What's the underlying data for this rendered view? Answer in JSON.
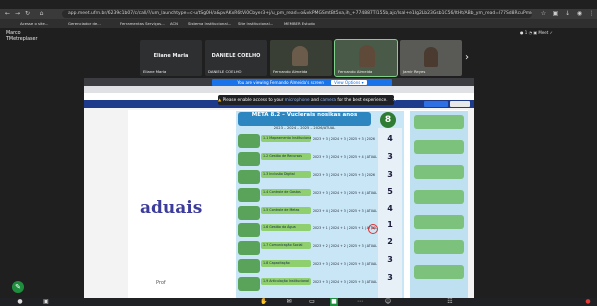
{
  "browser": {
    "url": "app.meet.ufrn.br/6239c1b07/c/call/?/um_launchtype=c-u/tSg0H/a&pvAKxR6tVi0Cbyer3+j/u_pm_read=o&vkPMGSmtBt5xa,ih_+774887Tl155b,ajc/Isal+e1Ig2Lb23Gsb1C56/ltHt/ABb_ym_read=l77Sd8RcuPmk",
    "bookmarks": [
      "Acesse o site...",
      "Gerenciador de...",
      "Ferramentas Serviços...",
      "ACN",
      "Sistema Institucional...",
      "Site Institucional...",
      "MEMBER Estudo"
    ]
  },
  "meet": {
    "header_name": "Marco\nTMetreplaser",
    "tools": "● 1  ◔  ▣ Meet  ✓",
    "participants": [
      {
        "big": "Eliane Maria",
        "small": "Eliane Maria"
      },
      {
        "big": "DANIELE COELHO",
        "small": "DANIELE COELHO"
      },
      {
        "big": "",
        "small": "Fernando Almeida"
      },
      {
        "big": "",
        "small": "Fernando Almeida"
      },
      {
        "big": "",
        "small": "Jamir Reyes"
      }
    ]
  },
  "shared": {
    "banner": "You are viewing Fernando Almeida's screen",
    "banner_btn": "View Options ▾",
    "notice_prefix": "Please enable access to your",
    "notice_link1": "microphone",
    "notice_mid": "and",
    "notice_link2": "camera",
    "notice_suffix": "for the best experience.",
    "notice_close": "✕",
    "slide_word": "aduais",
    "slide_presenter": "Prof",
    "meta_title": "META 8.2 – Vuclerais nosikas anos",
    "meta_years": "2023 – 2024 – 2025 – 2026/ATUAL",
    "badge": "8",
    "rows": [
      {
        "label": "1.1 Mapeamento Institucional",
        "years": "2023 + 3 | 2024 + 3 | 2025 + 3 | 2026"
      },
      {
        "label": "1.2 Gestão de Recursos",
        "years": "2023 + 3 | 2024 + 3 | 2025 + 4 | ATUAL"
      },
      {
        "label": "1.3 Inclusão Digital",
        "years": "2023 + 3 | 2024 + 3 | 2025 + 3 | 2026"
      },
      {
        "label": "1.4 Controle de Gastos",
        "years": "2023 + 3 | 2024 + 3 | 2025 + 4 | ATUAL"
      },
      {
        "label": "1.5 Controle de Metas",
        "years": "2023 + 4 | 2024 + 3 | 2025 + 3 | ATUAL"
      },
      {
        "label": "1.6 Gestão da Água",
        "years": "2023 + 1 | 2024 + 1 | 2025 + 1 | ATUAL"
      },
      {
        "label": "1.7 Comunicação Social",
        "years": "2023 + 2 | 2024 + 2 | 2025 + 3 | ATUAL"
      },
      {
        "label": "1.8 Capacitação",
        "years": "2023 + 3 | 2024 + 3 | 2025 + 3 | ATUAL"
      },
      {
        "label": "1.9 Articulação Institucional",
        "years": "2023 + 3 | 2024 + 3 | 2025 + 3 | ATUAL"
      }
    ],
    "numbers": [
      "4",
      "3",
      "3",
      "5",
      "4",
      "1",
      "2",
      "3",
      "3"
    ]
  }
}
